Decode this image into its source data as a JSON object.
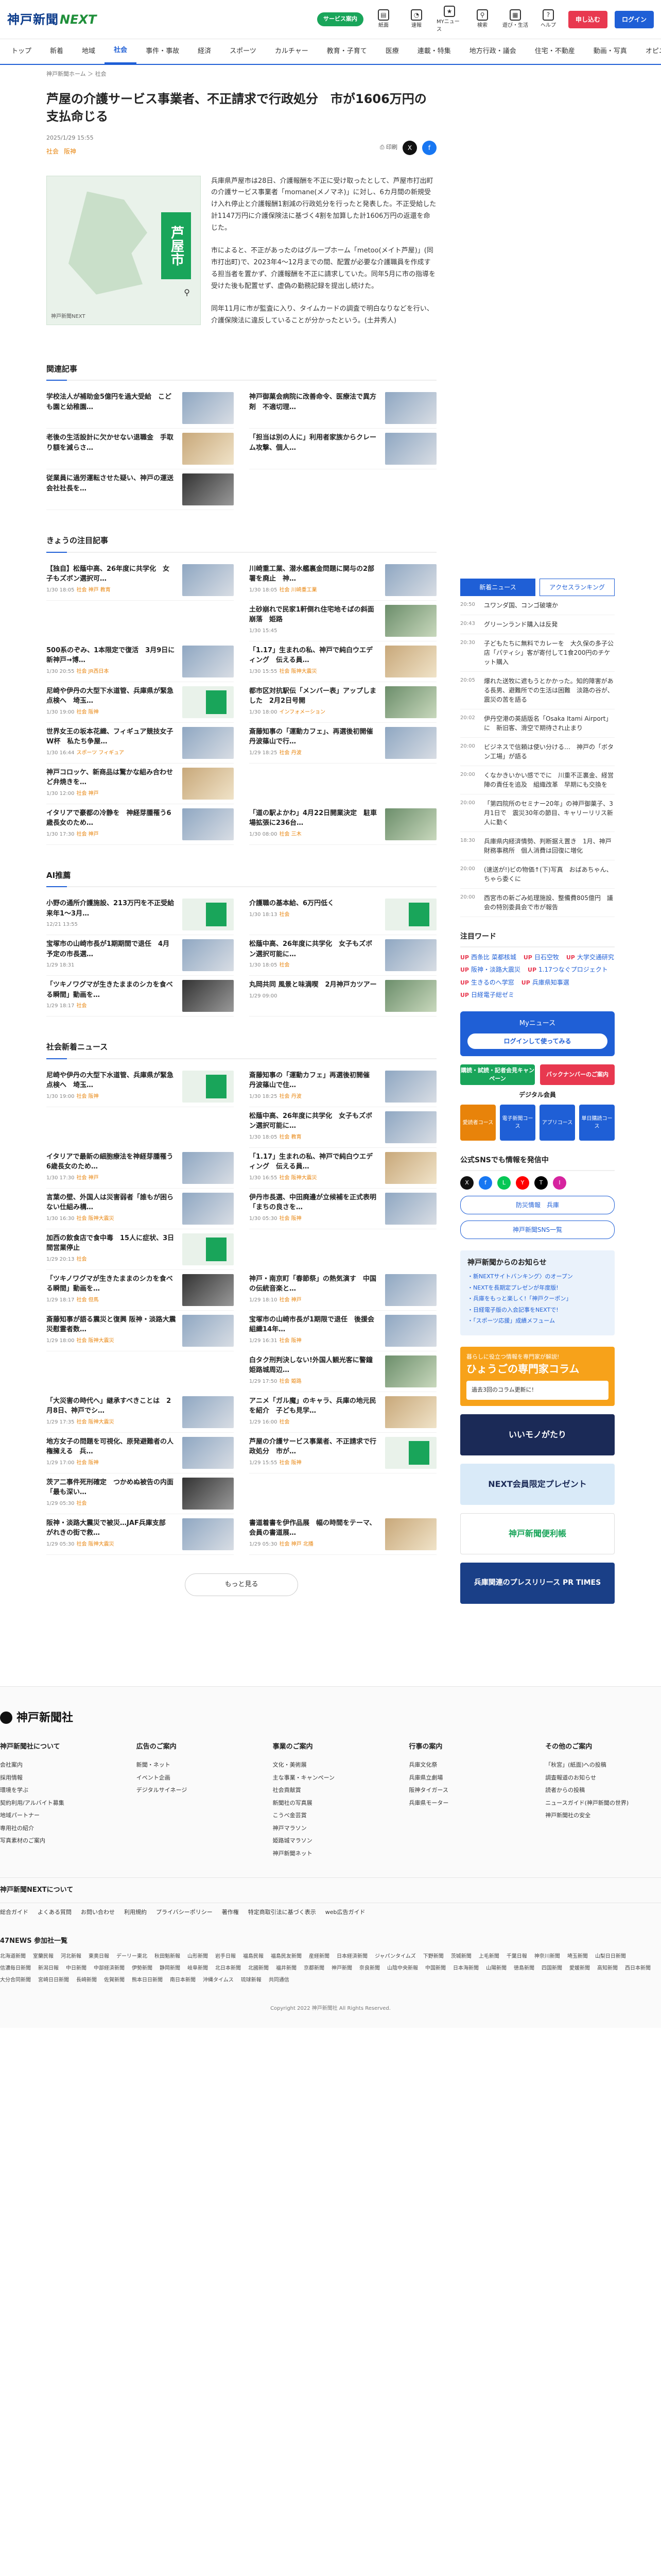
{
  "header": {
    "logo_kobe": "神戸新聞",
    "logo_next": "NEXT",
    "pill": "サービス案内",
    "icons": [
      {
        "label": "紙面"
      },
      {
        "label": "速報"
      },
      {
        "label": "MYニュース"
      },
      {
        "label": "検索"
      },
      {
        "label": "遊び・生活"
      },
      {
        "label": "ヘルプ"
      }
    ],
    "signup": "申し込む",
    "login": "ログイン"
  },
  "nav": [
    "トップ",
    "新着",
    "地域",
    "社会",
    "事件・事故",
    "経済",
    "スポーツ",
    "カルチャー",
    "教育・子育て",
    "医療",
    "連載・特集",
    "地方行政・議会",
    "住宅・不動産",
    "動画・写真",
    "オピニオン"
  ],
  "breadcrumb": "神戸新聞ホーム ＞ 社会",
  "article": {
    "title": "芦屋の介護サービス事業者、不正請求で行政処分　市が1606万円の支払命じる",
    "date": "2025/1/29 15:55",
    "tags": [
      "社会",
      "阪神"
    ],
    "share_print": "印刷",
    "map_label": "芦屋市",
    "map_credit": "神戸新聞NEXT",
    "paragraphs": [
      "兵庫県芦屋市は28日、介護報酬を不正に受け取ったとして、芦屋市打出町の介護サービス事業者「momane(メノマネ)」に対し、6カ月間の新規受け入れ停止と介護報酬1割減の行政処分を行ったと発表した。不正受給した計1147万円に介護保険法に基づく4割を加算した計1606万円の返還を命じた。",
      "市によると、不正があったのはグループホーム「metoo(メイト芦屋)」(同市打出町)で、2023年4〜12月までの間、配置が必要な介護職員を作成する担当者を置かず、介護報酬を不正に請求していた。同年5月に市の指導を受けた後も配置せず、虚偽の勤務記録を提出し続けた。",
      "同年11月に市が監査に入り、タイムカードの調査で明白なりなどを行い、介護保険法に違反していることが分かったという。(土井秀人)"
    ]
  },
  "related": {
    "heading": "関連記事",
    "items": [
      {
        "text": "学校法人が補助金5億円を過大受給　こども園と幼稚園…",
        "meta": "",
        "thumb": "photo1"
      },
      {
        "text": "神戸御菓会病院に改善命令、医療法で異方剤　不適切理…",
        "meta": "",
        "thumb": "photo1"
      },
      {
        "text": "老後の生活設計に欠かせない退職金　手取り額を減らさ…",
        "meta": "",
        "thumb": "photo2"
      },
      {
        "text": "「担当は別の人に」利用者家族からクレーム攻撃、個人…",
        "meta": "",
        "thumb": "photo1"
      },
      {
        "text": "従業員に過労運転させた疑い、神戸の運送会社社長を…",
        "meta": "",
        "thumb": "photo4"
      }
    ]
  },
  "featured": {
    "heading": "きょうの注目記事",
    "items": [
      {
        "text": "【独自】松蔭中高、26年度に共学化　女子もズボン選択可…",
        "meta": "1/30 18:05",
        "tag": "社会 神戸 教育",
        "thumb": "photo1"
      },
      {
        "text": "川崎重工業、潜水艦裏金問題に関与の2部署を廃止　神…",
        "meta": "1/30 18:05",
        "tag": "社会 川崎重工業",
        "thumb": "photo1"
      },
      {
        "text": "",
        "meta": "",
        "tag": "",
        "thumb": ""
      },
      {
        "text": "土砂崩れで民家1軒倒れ住宅地そばの斜面崩落　姫路",
        "meta": "1/30 15:45",
        "tag": "",
        "thumb": "photo3"
      },
      {
        "text": "500系のぞみ、1本限定で復活　3月9日に新神戸→博…",
        "meta": "1/30 20:55",
        "tag": "社会 JR西日本",
        "thumb": "photo1"
      },
      {
        "text": "「1.17」生まれの私、神戸で純白ウエディング　伝える員…",
        "meta": "1/30 15:55",
        "tag": "社会 阪神大震災",
        "thumb": "photo2"
      },
      {
        "text": "尼崎や伊丹の大型下水道管、兵庫県が緊急点検へ　埼玉…",
        "meta": "1/30 19:00",
        "tag": "社会 阪神",
        "thumb": "map-t"
      },
      {
        "text": "都市区対抗駅伝「メンバー表」アップしました　2月2日号開",
        "meta": "1/30 18:00",
        "tag": "インフォメーション",
        "thumb": "photo3"
      },
      {
        "text": "世界女王の坂本花織、フィギュア競技女子　W杯　私たち争屋…",
        "meta": "1/30 16:44",
        "tag": "スポーツ フィギュア",
        "thumb": "photo1"
      },
      {
        "text": "斎藤知事の「運動カフェ」、再選後初開催　丹波篠山で行…",
        "meta": "1/29 18:25",
        "tag": "社会 丹波",
        "thumb": "photo1"
      },
      {
        "text": "神戸コロッケ、新商品は驚かな組み合わせ　ど弁焼きを…",
        "meta": "1/30 12:00",
        "tag": "社会 神戸",
        "thumb": "photo2"
      },
      {
        "text": "",
        "meta": "",
        "tag": "",
        "thumb": ""
      },
      {
        "text": "イタリアで豪都の冷静を　神経芽腫罹う6歳長女のため…",
        "meta": "1/30 17:30",
        "tag": "社会 神戸",
        "thumb": "photo1"
      },
      {
        "text": "「道の駅よかわ」4月22日開業決定　駐車場拡張に236台…",
        "meta": "1/30 08:00",
        "tag": "社会 三木",
        "thumb": "photo3"
      }
    ]
  },
  "ai": {
    "heading": "AI推薦",
    "items": [
      {
        "text": "小野の通所介護施設、213万円を不正受給　来年1〜3月…",
        "meta": "12/21 13:55",
        "tag": "",
        "thumb": "map-t"
      },
      {
        "text": "介護職の基本給、6万円低く",
        "meta": "1/30 18:13",
        "tag": "社会",
        "thumb": "map-t"
      },
      {
        "text": "宝塚市の山崎市長が1期期間で退任　4月予定の市長選…",
        "meta": "1/29 18:31",
        "tag": "",
        "thumb": "photo1"
      },
      {
        "text": "松蔭中高、26年度に共学化　女子もズボン選択可能に…",
        "meta": "1/30 18:05",
        "tag": "社会",
        "thumb": "photo1"
      },
      {
        "text": "「ツキノワグマが生きたままのシカを食べる瞬間」動画を…",
        "meta": "1/29 18:17",
        "tag": "社会",
        "thumb": "photo4"
      },
      {
        "text": "丸岡共同 風景と味満喫　2月神戸カツアー",
        "meta": "1/29 09:00",
        "tag": "",
        "thumb": "photo3"
      }
    ]
  },
  "social": {
    "heading": "社会新着ニュース",
    "items": [
      {
        "text": "尼崎や伊丹の大型下水道管、兵庫県が緊急点検へ　埼玉…",
        "meta": "1/30 19:00",
        "tag": "社会 阪神",
        "thumb": "map-t"
      },
      {
        "text": "斎藤知事の「運動カフェ」再選後初開催　丹波篠山で住…",
        "meta": "1/30 18:25",
        "tag": "社会 丹波",
        "thumb": "photo1"
      },
      {
        "text": "",
        "meta": "",
        "tag": "",
        "thumb": ""
      },
      {
        "text": "松蔭中高、26年度に共学化　女子もズボン選択可能に…",
        "meta": "1/30 18:05",
        "tag": "社会 教育",
        "thumb": "photo1"
      },
      {
        "text": "イタリアで最新の細胞療法を神経芽腫罹う6歳長女のため…",
        "meta": "1/30 17:30",
        "tag": "社会 神戸",
        "thumb": "photo1"
      },
      {
        "text": "「1.17」生まれの私、神戸で純白ウエディング　伝える員…",
        "meta": "1/30 16:55",
        "tag": "社会 阪神大震災",
        "thumb": "photo2"
      },
      {
        "text": "言葉の壁、外国人は災害弱者「誰もが困らない仕組み構…",
        "meta": "1/30 16:30",
        "tag": "社会 阪神大震災",
        "thumb": "photo1"
      },
      {
        "text": "伊丹市長選、中田廃邊が立候補を正式表明「まちの良さを…",
        "meta": "1/30 05:30",
        "tag": "社会 阪神",
        "thumb": "photo1"
      },
      {
        "text": "加西の飲食店で食中毒　15人に症状、3日間営業停止",
        "meta": "1/29 20:13",
        "tag": "社会",
        "thumb": "map-t"
      },
      {
        "text": "",
        "meta": "",
        "tag": "",
        "thumb": ""
      },
      {
        "text": "「ツキノワグマが生きたままのシカを食べる瞬間」動画を…",
        "meta": "1/29 18:17",
        "tag": "社会 但馬",
        "thumb": "photo4"
      },
      {
        "text": "神戸・南京町「春節祭」の熱気演す　中国の伝統音楽と…",
        "meta": "1/29 18:10",
        "tag": "社会 神戸",
        "thumb": "photo1"
      },
      {
        "text": "斎藤知事が語る震災と復興 阪神・淡路大震災慰霊者数…",
        "meta": "1/29 18:00",
        "tag": "社会 阪神大震災",
        "thumb": "photo1"
      },
      {
        "text": "宝塚市の山崎市長が1期限で退任　後援会組織14年…",
        "meta": "1/29 16:31",
        "tag": "社会 阪神",
        "thumb": "photo1"
      },
      {
        "text": "",
        "meta": "",
        "tag": "",
        "thumb": ""
      },
      {
        "text": "白タク刑判決しない!外国人観光客に警鐘　姫路城周辺…",
        "meta": "1/29 17:50",
        "tag": "社会 姫路",
        "thumb": "photo3"
      },
      {
        "text": "「大災害の時代へ」継承すべきことは　2月8日、神戸でシ…",
        "meta": "1/29 17:35",
        "tag": "社会 阪神大震災",
        "thumb": "photo1"
      },
      {
        "text": "アニメ「ガル魔」のキャラ、兵庫の地元民を紹介　子ども見学…",
        "meta": "1/29 16:00",
        "tag": "社会",
        "thumb": "photo2"
      },
      {
        "text": "地方女子の問題を可視化、原発避難者の人権擁える　兵…",
        "meta": "1/29 17:00",
        "tag": "社会 阪神",
        "thumb": "photo1"
      },
      {
        "text": "芦屋の介護サービス事業者、不正請求で行政処分　市が…",
        "meta": "1/29 15:55",
        "tag": "社会 阪神",
        "thumb": "map-t"
      },
      {
        "text": "茨ア二事件死刑確定　つかめぬ被告の内面「最も深い…",
        "meta": "1/29 05:30",
        "tag": "社会",
        "thumb": "photo4"
      },
      {
        "text": "",
        "meta": "",
        "tag": "",
        "thumb": ""
      },
      {
        "text": "阪神・淡路大震災で被災…JAF兵庫支部　がれきの街で救…",
        "meta": "1/29 05:30",
        "tag": "社会 阪神大震災",
        "thumb": "photo1"
      },
      {
        "text": "書道着書を伊作品展　幅の時間をテーマ、会員の書道展…",
        "meta": "1/29 05:30",
        "tag": "社会 神戸 北播",
        "thumb": "photo2"
      }
    ],
    "more": "もっと見る"
  },
  "sidebar": {
    "tabs": [
      "新着ニュース",
      "アクセスランキング"
    ],
    "news": [
      {
        "t": "20:50",
        "text": "ユワンダ国、コンゴ破壊か"
      },
      {
        "t": "20:43",
        "text": "グリーンランド購入は反発"
      },
      {
        "t": "20:30",
        "text": "子どもたちに無料でカレーを　大久保の多子公店「パティシ」客が寄付して1食200円のチケット購入"
      },
      {
        "t": "20:05",
        "text": "爆れた送牧に遮もうとかかった。知的障害がある長男、避難所での生活は困難　淡路の谷が、震災の苦を語る"
      },
      {
        "t": "20:02",
        "text": "伊丹空港の英語版名「Osaka Itami Airport」に　新旧客、滑空で期待され止まり"
      },
      {
        "t": "20:00",
        "text": "ビジネスで信頼は使い分ける…　神戸の「ボタン工場」が語る"
      },
      {
        "t": "20:00",
        "text": "くなかきいかい感ででに　川重不正裏金、経営陣の責任を追及　組織改革　早期にも交換を"
      },
      {
        "t": "20:00",
        "text": "「第四院所のセミナー20年」の神戸御菓子、3月1日で　震災30年の節目、キャリーリリス新人に勤く"
      },
      {
        "t": "18:30",
        "text": "兵庫県内経済情勢、判断据え置き　1月、神戸財務事務所　個人消費は回復に増化"
      },
      {
        "t": "20:00",
        "text": "(速送が!)ビの物価↑(下)写真　おばあちゃん、ちゃら委くに"
      },
      {
        "t": "20:00",
        "text": "西宮市の新ごみ処理施設、整備費805億円　議会の特別委員会で市が報告"
      }
    ],
    "attention_heading": "注目ワード",
    "words": [
      {
        "up": "UP",
        "w": "西条比 菜都核城"
      },
      {
        "up": "UP",
        "w": "日石空牧"
      },
      {
        "up": "UP",
        "w": "大学交通研究"
      },
      {
        "up": "UP",
        "w": "阪神・淡路大震災"
      },
      {
        "up": "UP",
        "w": "1.17つなぐプロジェクト"
      },
      {
        "up": "UP",
        "w": "生きるのへ学窓"
      },
      {
        "up": "UP",
        "w": "兵庫県知事選"
      },
      {
        "up": "UP",
        "w": "日経電子総ゼミ"
      }
    ],
    "mynews_title": "Myニュース",
    "mynews_btn": "ログインして使ってみる",
    "banners": [
      "購読・試読・記者会見キャンペーン",
      "バックナンバーのご案内"
    ],
    "digital_title": "デジタル会員",
    "courses": [
      "愛読者コース",
      "電子新聞コース",
      "アプリコース",
      "単日購読コース"
    ],
    "sns_heading": "公式SNSでも情報を発信中",
    "sns": [
      "X",
      "f",
      "L",
      "Y",
      "T",
      "I"
    ],
    "link1": "防災情報　兵庫",
    "link2": "神戸新聞SNS一覧",
    "notice_heading": "神戸新聞からのお知らせ",
    "notices": [
      "・新NEXTサイトバンキング〉のオープン",
      "・NEXTを長期定プレゼンが年度版!",
      "・兵庫をもっと楽しく!「神戸クーポン」",
      "・日経電子版の入会記事をNEXTで!",
      "・「スポーツ応援」成績メフューム"
    ],
    "expert_small": "暮らしに役立つ情報を専門家が解説!",
    "expert_big": "ひょうごの専門家コラム",
    "expert_card": "過去3回のコラム更新に!",
    "banner_iinemogatari": "いいモノがたり",
    "banner_present": "NEXT会員限定プレゼント",
    "banner_benri": "神戸新聞便利帳",
    "banner_prt": "兵庫関連のプレスリリース PR TIMES"
  },
  "footer": {
    "logo": "神戸新聞社",
    "cols": [
      {
        "h": "神戸新聞社について",
        "items": [
          "会社案内",
          "採用情報",
          "環境を学ぶ",
          "契約利用/アルバイト募集",
          "地域パートナー",
          "専用社の紹介",
          "写真素材のご案内"
        ]
      },
      {
        "h": "広告のご案内",
        "items": [
          "新聞・ネット",
          "イベント企画",
          "デジタルサイネージ"
        ]
      },
      {
        "h": "事業のご案内",
        "items": [
          "文化・美術展",
          "主な事業・キャンペーン",
          "社会貢献賞",
          "新聞社の写真展",
          "こうべ金芸賞",
          "神戸マラソン",
          "姫路城マラソン",
          "神戸新聞ネット"
        ]
      },
      {
        "h": "行事の案内",
        "items": [
          "兵庫文化祭",
          "兵庫県立劇場",
          "阪神タイガース",
          "兵庫県モーター"
        ]
      },
      {
        "h": "その他のご案内",
        "items": [
          "「秋宮」(紙面)への投稿",
          "調査報道のお知らせ",
          "読者からの投稿",
          "ニュースガイド(神戸新聞の世界)",
          "神戸新聞社の安全"
        ]
      }
    ],
    "band": "神戸新聞NEXTについて",
    "links": [
      "総合ガイド",
      "よくある質問",
      "お問い合わせ",
      "利用規約",
      "プライバシーポリシー",
      "著作権",
      "特定商取引法に基づく表示",
      "web広告ガイド"
    ],
    "n47": "47NEWS 参加社一覧",
    "n47_list": [
      "北海道新聞",
      "室蘭民報",
      "河北新報",
      "東奥日報",
      "デーリー東北",
      "秋田魁新報",
      "山形新聞",
      "岩手日報",
      "福島民報",
      "福島民友新聞",
      "産経新聞",
      "日本経済新聞",
      "ジャパンタイムズ",
      "下野新聞",
      "茨城新聞",
      "上毛新聞",
      "千葉日報",
      "神奈川新聞",
      "埼玉新聞",
      "山梨日日新聞",
      "信濃毎日新聞",
      "新潟日報",
      "中日新聞",
      "中部経済新聞",
      "伊勢新聞",
      "静岡新聞",
      "岐阜新聞",
      "北日本新聞",
      "北國新聞",
      "福井新聞",
      "京都新聞",
      "神戸新聞",
      "奈良新聞",
      "山陰中央新報",
      "中国新聞",
      "日本海新聞",
      "山陽新聞",
      "徳島新聞",
      "四国新聞",
      "愛媛新聞",
      "高知新聞",
      "西日本新聞",
      "大分合同新聞",
      "宮崎日日新聞",
      "長崎新聞",
      "佐賀新聞",
      "熊本日日新聞",
      "南日本新聞",
      "沖縄タイムス",
      "琉球新報",
      "共同通信"
    ],
    "copyright": "Copyright 2022 神戸新聞社 All Rights Reserved."
  }
}
